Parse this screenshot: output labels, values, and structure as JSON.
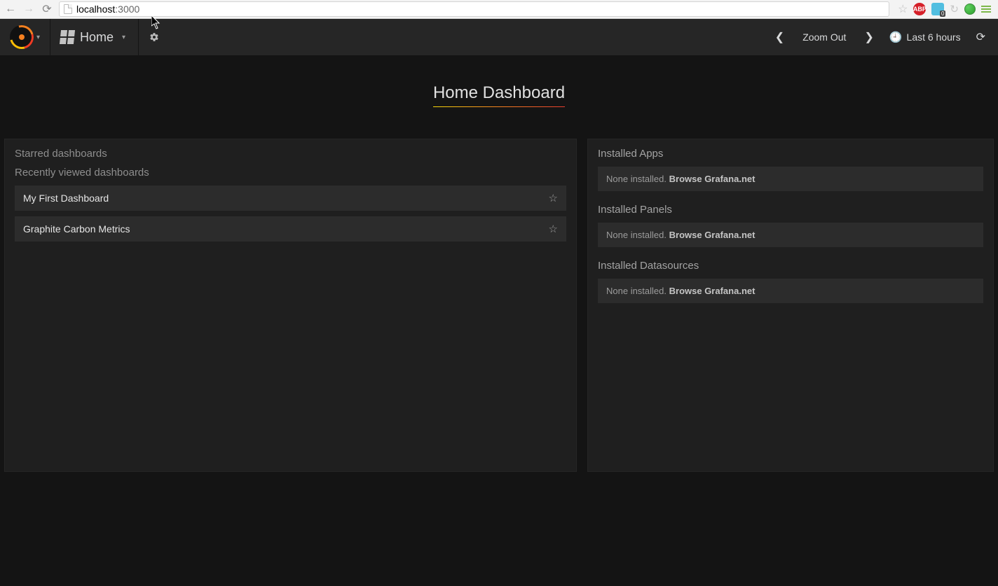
{
  "browser": {
    "url_host": "localhost",
    "url_port": ":3000"
  },
  "navbar": {
    "home_label": "Home",
    "zoom_out_label": "Zoom Out",
    "time_range_label": "Last 6 hours"
  },
  "page": {
    "title": "Home Dashboard"
  },
  "left_panel": {
    "starred_heading": "Starred dashboards",
    "recent_heading": "Recently viewed dashboards",
    "recent": [
      {
        "name": "My First Dashboard"
      },
      {
        "name": "Graphite Carbon Metrics"
      }
    ]
  },
  "right_panel": {
    "sections": [
      {
        "heading": "Installed Apps",
        "empty_prefix": "None installed. ",
        "link": "Browse Grafana.net"
      },
      {
        "heading": "Installed Panels",
        "empty_prefix": "None installed. ",
        "link": "Browse Grafana.net"
      },
      {
        "heading": "Installed Datasources",
        "empty_prefix": "None installed. ",
        "link": "Browse Grafana.net"
      }
    ]
  }
}
